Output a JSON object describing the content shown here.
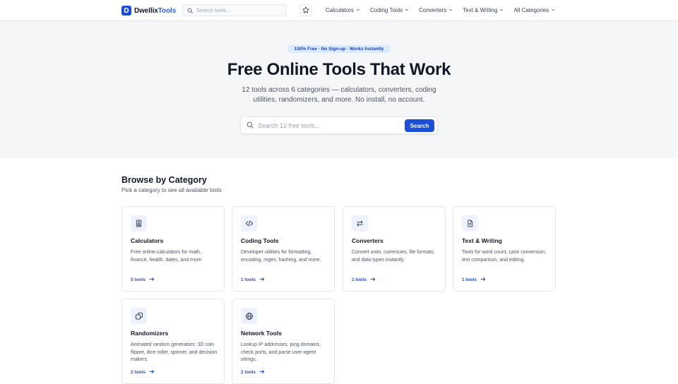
{
  "brand": {
    "mark": "D",
    "name_plain": "Dwellix",
    "name_accent": "Tools",
    "accent_color": "#2563eb"
  },
  "nav": {
    "search_placeholder": "Search tools...",
    "menu": [
      {
        "label": "Calculators"
      },
      {
        "label": "Coding Tools"
      },
      {
        "label": "Converters"
      },
      {
        "label": "Text & Writing"
      },
      {
        "label": "All Categories"
      }
    ]
  },
  "hero": {
    "badge": "100% Free · No Sign-up · Works Instantly",
    "title": "Free Online Tools That Work",
    "subtitle": "12 tools across 6 categories — calculators, converters, coding utilities, randomizers, and more. No install, no account.",
    "search_placeholder": "Search 12 free tools...",
    "search_button": "Search"
  },
  "browse": {
    "title": "Browse by Category",
    "subtitle": "Pick a category to see all available tools",
    "cards": [
      {
        "title": "Calculators",
        "desc": "Free online calculators for math, finance, health, dates, and more.",
        "link": "5 tools",
        "icon": "calculator-icon"
      },
      {
        "title": "Coding Tools",
        "desc": "Developer utilities for formatting, encoding, regex, hashing, and more.",
        "link": "1 tools",
        "icon": "code-icon"
      },
      {
        "title": "Converters",
        "desc": "Convert units, currencies, file formats, and data types instantly.",
        "link": "1 tools",
        "icon": "swap-arrows-icon"
      },
      {
        "title": "Text & Writing",
        "desc": "Tools for word count, case conversion, text comparison, and editing.",
        "link": "1 tools",
        "icon": "document-icon"
      },
      {
        "title": "Randomizers",
        "desc": "Animated random generators: 3D coin flipper, dice roller, spinner, and decision makers.",
        "link": "2 tools",
        "icon": "dice-icon"
      },
      {
        "title": "Network Tools",
        "desc": "Lookup IP addresses, ping domains, check ports, and parse user-agent strings.",
        "link": "2 tools",
        "icon": "globe-icon"
      }
    ]
  }
}
